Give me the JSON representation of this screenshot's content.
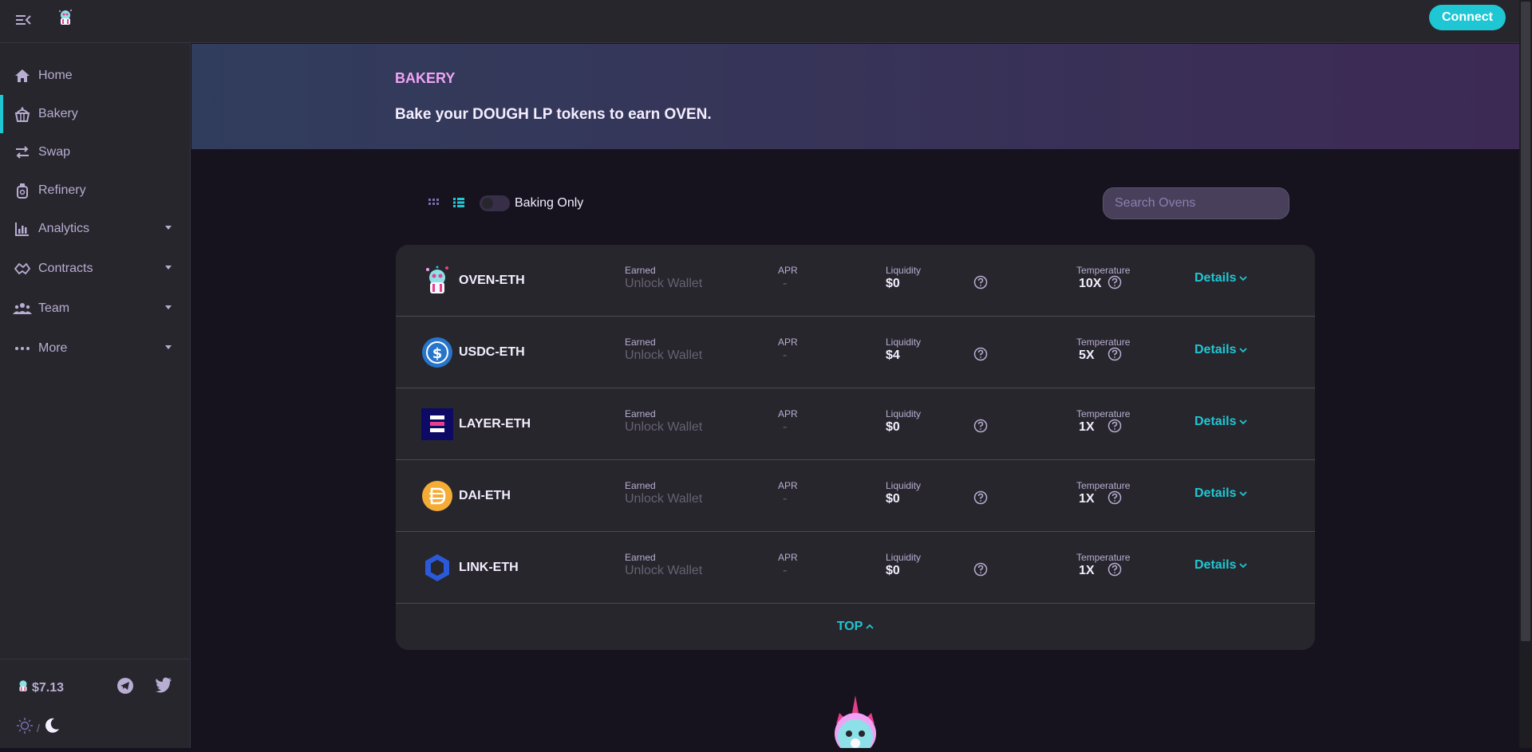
{
  "topbar": {
    "connect_label": "Connect"
  },
  "sidebar": {
    "items": [
      {
        "label": "Home",
        "icon": "home-icon"
      },
      {
        "label": "Bakery",
        "icon": "bakery-icon",
        "active": true
      },
      {
        "label": "Swap",
        "icon": "swap-icon"
      },
      {
        "label": "Refinery",
        "icon": "refinery-icon"
      },
      {
        "label": "Analytics",
        "icon": "analytics-icon",
        "has_submenu": true
      },
      {
        "label": "Contracts",
        "icon": "contracts-icon",
        "has_submenu": true
      },
      {
        "label": "Team",
        "icon": "team-icon",
        "has_submenu": true
      },
      {
        "label": "More",
        "icon": "more-icon",
        "has_submenu": true
      }
    ],
    "footer": {
      "price": "$7.13",
      "theme_separator": "/"
    }
  },
  "banner": {
    "kicker": "BAKERY",
    "title": "Bake your DOUGH LP tokens to earn OVEN."
  },
  "controls": {
    "toggle_label": "Baking Only",
    "toggle_on": false,
    "search_placeholder": "Search Ovens"
  },
  "table": {
    "labels": {
      "earned": "Earned",
      "apr": "APR",
      "liquidity": "Liquidity",
      "temperature": "Temperature",
      "details": "Details"
    },
    "rows": [
      {
        "pair": "OVEN-ETH",
        "icon": "oven-token-icon",
        "earned": "Unlock Wallet",
        "apr": "-",
        "liquidity": "$0",
        "temperature": "10X"
      },
      {
        "pair": "USDC-ETH",
        "icon": "usdc-token-icon",
        "earned": "Unlock Wallet",
        "apr": "-",
        "liquidity": "$4",
        "temperature": "5X"
      },
      {
        "pair": "LAYER-ETH",
        "icon": "layer-token-icon",
        "earned": "Unlock Wallet",
        "apr": "-",
        "liquidity": "$0",
        "temperature": "1X"
      },
      {
        "pair": "DAI-ETH",
        "icon": "dai-token-icon",
        "earned": "Unlock Wallet",
        "apr": "-",
        "liquidity": "$0",
        "temperature": "1X"
      },
      {
        "pair": "LINK-ETH",
        "icon": "link-token-icon",
        "earned": "Unlock Wallet",
        "apr": "-",
        "liquidity": "$0",
        "temperature": "1X"
      }
    ],
    "top_label": "TOP"
  },
  "colors": {
    "accent": "#1fc7d4",
    "kicker": "#f0a3f5",
    "text_secondary": "#b8add2",
    "card": "#27262c",
    "background": "#16131e"
  }
}
